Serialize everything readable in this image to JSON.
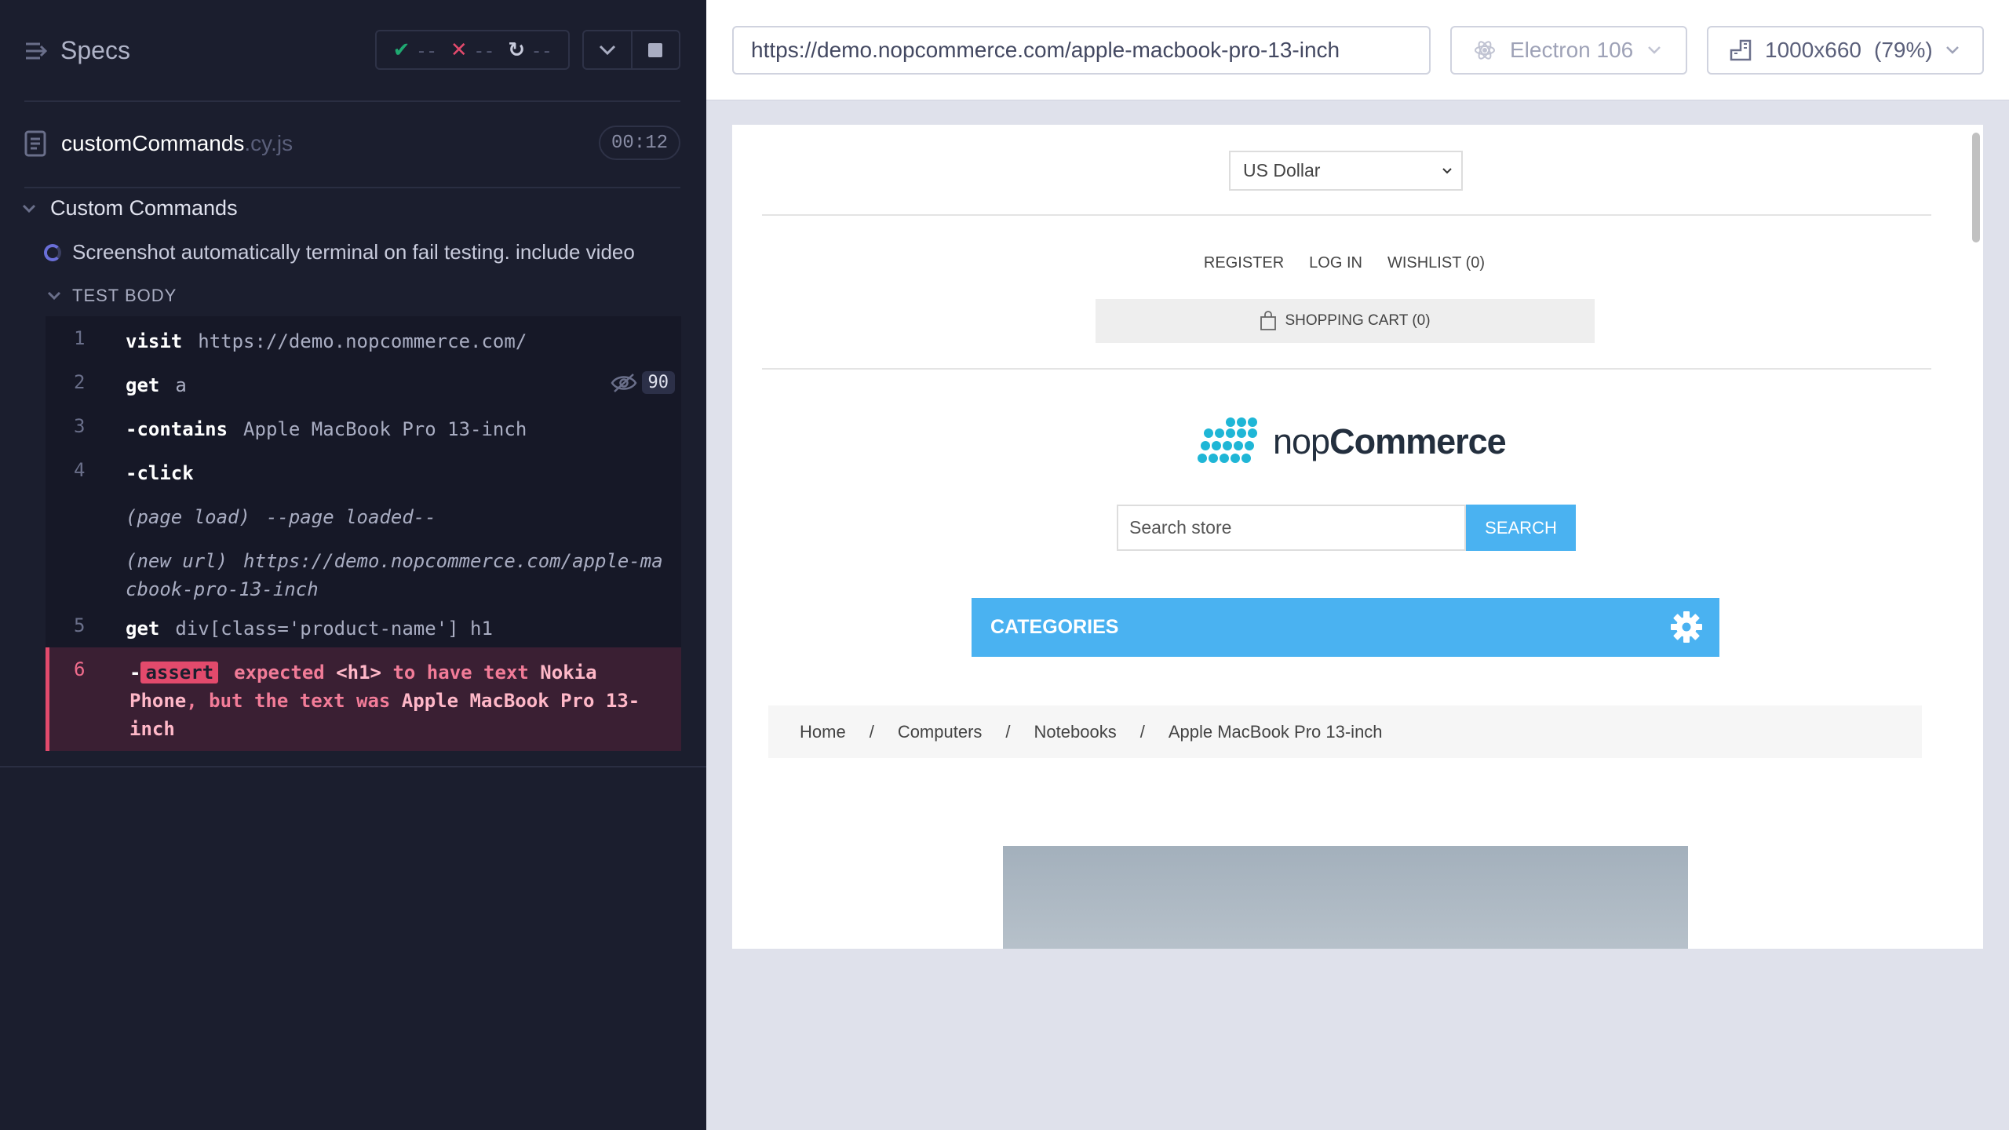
{
  "reporter": {
    "specs_label": "Specs",
    "stats": {
      "passed": "--",
      "failed": "--",
      "pending": "--"
    },
    "spec": {
      "name": "customCommands",
      "ext": ".cy.js",
      "duration": "00:12"
    },
    "suite_title": "Custom Commands",
    "test_title": "Screenshot automatically terminal on fail testing. include video",
    "test_body_label": "TEST BODY",
    "commands": [
      {
        "num": "1",
        "name": "visit",
        "arg": "https://demo.nopcommerce.com/"
      },
      {
        "num": "2",
        "name": "get",
        "arg": "a",
        "pin_count": "90"
      },
      {
        "num": "3",
        "name": "-contains",
        "arg": "Apple MacBook Pro 13-inch"
      },
      {
        "num": "4",
        "name": "-click",
        "arg": ""
      },
      {
        "num": "",
        "event": "(page load)",
        "arg": "--page loaded--"
      },
      {
        "num": "",
        "event": "(new url)",
        "arg": "https://demo.nopcommerce.com/apple-macbook-pro-13-inch"
      },
      {
        "num": "5",
        "name": "get",
        "arg": "div[class='product-name'] h1"
      }
    ],
    "failed_command": {
      "num": "6",
      "prefix": "-",
      "badge": "assert",
      "t1": "expected",
      "el": "<h1>",
      "t2": "to have text",
      "expected": "Nokia Phone",
      "t3": ", but the text was",
      "actual": "Apple MacBook Pro 13-inch"
    }
  },
  "aut": {
    "url": "https://demo.nopcommerce.com/apple-macbook-pro-13-inch",
    "browser": "Electron 106",
    "viewport": "1000x660",
    "scale": "(79%)",
    "site": {
      "currency": "US Dollar",
      "links": [
        "REGISTER",
        "LOG IN",
        "WISHLIST (0)"
      ],
      "cart": "SHOPPING CART (0)",
      "logo_light": "nop",
      "logo_bold": "Commerce",
      "search_placeholder": "Search store",
      "search_button": "SEARCH",
      "categories": "CATEGORIES",
      "breadcrumb": [
        "Home",
        "Computers",
        "Notebooks",
        "Apple MacBook Pro 13-inch"
      ],
      "accent": "#4ab2f1"
    }
  },
  "colors": {
    "reporter_bg": "#1b1e2e",
    "fail": "#e24a6c",
    "passed": "#1fa971",
    "failed": "#e24a6c"
  }
}
